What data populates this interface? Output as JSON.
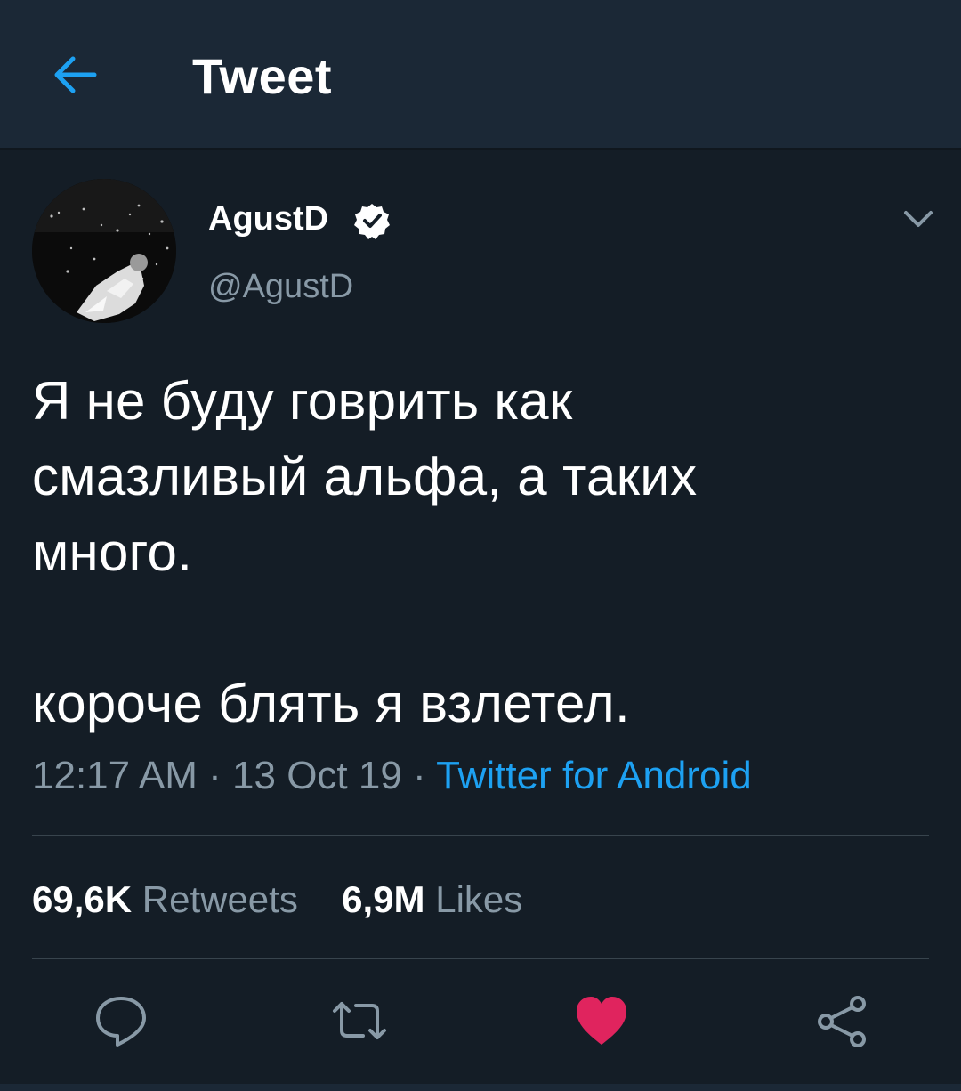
{
  "header": {
    "title": "Tweet"
  },
  "author": {
    "name": "AgustD",
    "handle": "@AgustD",
    "verified": true
  },
  "tweet": {
    "text": "Я не буду говрить как\nсмазливый альфа, а таких\nмного.\n\nкороче блять я взлетел.",
    "time": "12:17 AM",
    "date": "13 Oct 19",
    "separator": "·",
    "source": "Twitter for Android"
  },
  "stats": {
    "retweets_count": "69,6K",
    "retweets_label": "Retweets",
    "likes_count": "6,9M",
    "likes_label": "Likes"
  },
  "actions": [
    {
      "icon": "reply-icon"
    },
    {
      "icon": "retweet-icon"
    },
    {
      "icon": "like-icon",
      "active": true
    },
    {
      "icon": "share-icon"
    }
  ],
  "colors": {
    "background": "#141d26",
    "header_bg": "#1b2836",
    "accent": "#1da1f2",
    "secondary_text": "#8899a6",
    "like": "#e0245e",
    "divider": "#38444d"
  }
}
